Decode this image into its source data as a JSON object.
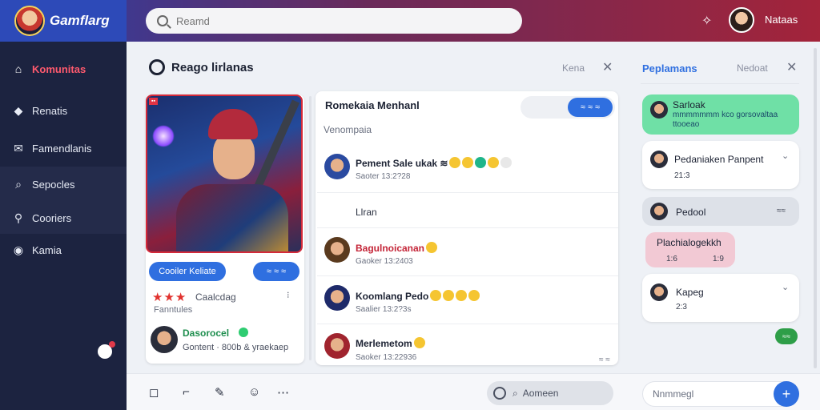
{
  "app": {
    "brand": "Gamflarg",
    "user_name": "Nataas"
  },
  "search": {
    "placeholder": "Reamd"
  },
  "sidebar": {
    "items": [
      {
        "label": "Komunitas",
        "icon": "home-icon",
        "active": true
      },
      {
        "label": "Renatis",
        "icon": "tag-icon"
      },
      {
        "label": "Famendlanis",
        "icon": "mail-icon"
      },
      {
        "label": "Sepocles",
        "icon": "search-icon"
      },
      {
        "label": "Cooriers",
        "icon": "chart-icon"
      },
      {
        "label": "Kamia",
        "icon": "globe-icon"
      }
    ]
  },
  "main": {
    "title": "Reago lirlanas",
    "link": "Kena",
    "card": {
      "primary_button": "Cooiler Keliate",
      "secondary_button": "≈ ≈ ≈",
      "rating_label": "Caalcdag",
      "rating_sub": "Fanntules",
      "rating_dots": "⁝",
      "user_name": "Dasorocel",
      "user_sub": "Gontent · 800b & yraekaep"
    },
    "chat": {
      "heading": "Romekaia Menhanl",
      "tab_label": "≈ ≈ ≈",
      "sub": "Venompaia",
      "plain_message": "Llran",
      "messages": [
        {
          "name": "Pement Sale ukak ≋",
          "time": "Saoter 13:2?28"
        },
        {
          "name": "Bagulnoicanan",
          "time": "Gaoker 13:2403"
        },
        {
          "name": "Koomlang Pedo",
          "time": "Saalier 13:2?3s"
        },
        {
          "name": "Merlemetom",
          "time": "Saoker 13:22936"
        }
      ],
      "footer_dots": "≈ ≈"
    }
  },
  "bottom": {
    "comment_label": "Aomeen",
    "input_placeholder": "Nnmmegl"
  },
  "right": {
    "title": "Peplamans",
    "link": "Nedoat",
    "bubbles": [
      {
        "title": "Sarloak",
        "sub": "mmmmmmm kco gorsovaltaa ttooeao"
      },
      {
        "title": "Pedaniaken Panpent",
        "sub": "21:3"
      },
      {
        "title": "Pedool",
        "sub": "≈≈"
      },
      {
        "title": "Plachialogekkh",
        "sub1": "1:6",
        "sub2": "1:9"
      },
      {
        "title": "Kapeg",
        "sub": "2:3"
      }
    ],
    "badge": "≈≈"
  }
}
